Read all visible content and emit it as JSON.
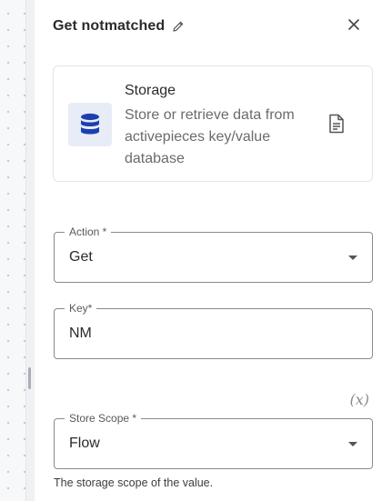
{
  "step": {
    "title": "Get notmatched"
  },
  "piece": {
    "name": "Storage",
    "description": "Store or retrieve data from activepieces key/value database",
    "logo_icon": "database-icon",
    "docs_icon": "document-icon"
  },
  "fields": {
    "action": {
      "label": "Action *",
      "value": "Get"
    },
    "key": {
      "label": "Key*",
      "value": "NM"
    },
    "store_scope": {
      "label": "Store Scope *",
      "value": "Flow",
      "helper": "The storage scope of the value."
    }
  },
  "dynamic_toggle": {
    "label": "(x)"
  },
  "colors": {
    "logo_bg": "#e8ecf7",
    "logo_fg": "#1c3fb0",
    "border": "#8a8a8a"
  }
}
